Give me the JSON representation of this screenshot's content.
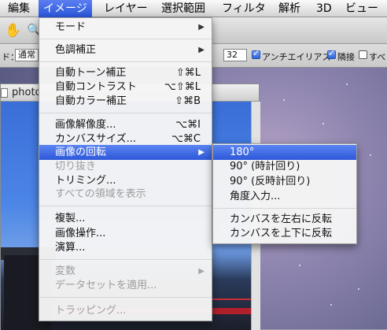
{
  "menubar": {
    "items": [
      "編集",
      "イメージ",
      "レイヤー",
      "選択範囲",
      "フィルタ",
      "解析",
      "3D",
      "ビュー"
    ],
    "active_index": 1
  },
  "toolbar": {
    "mode_label": "ド：",
    "mode_value": "通常",
    "size_value": "32",
    "antialias_label": "アンチエイリアス",
    "contiguous_label": "隣接",
    "all_layers_label": "すべ"
  },
  "document": {
    "title": "photo"
  },
  "image_menu": {
    "items": [
      {
        "label": "モード",
        "shortcut": "",
        "submenu": true,
        "disabled": false
      },
      {
        "label": "色調補正",
        "shortcut": "",
        "submenu": true,
        "disabled": false
      },
      {
        "label": "自動トーン補正",
        "shortcut": "⇧⌘L",
        "submenu": false,
        "disabled": false
      },
      {
        "label": "自動コントラスト",
        "shortcut": "⌥⇧⌘L",
        "submenu": false,
        "disabled": false
      },
      {
        "label": "自動カラー補正",
        "shortcut": "⇧⌘B",
        "submenu": false,
        "disabled": false
      },
      {
        "label": "画像解像度...",
        "shortcut": "⌥⌘I",
        "submenu": false,
        "disabled": false
      },
      {
        "label": "カンバスサイズ...",
        "shortcut": "⌥⌘C",
        "submenu": false,
        "disabled": false
      },
      {
        "label": "画像の回転",
        "shortcut": "",
        "submenu": true,
        "disabled": false,
        "highlighted": true
      },
      {
        "label": "切り抜き",
        "shortcut": "",
        "submenu": false,
        "disabled": true
      },
      {
        "label": "トリミング...",
        "shortcut": "",
        "submenu": false,
        "disabled": false
      },
      {
        "label": "すべての領域を表示",
        "shortcut": "",
        "submenu": false,
        "disabled": true
      },
      {
        "label": "複製...",
        "shortcut": "",
        "submenu": false,
        "disabled": false
      },
      {
        "label": "画像操作...",
        "shortcut": "",
        "submenu": false,
        "disabled": false
      },
      {
        "label": "演算...",
        "shortcut": "",
        "submenu": false,
        "disabled": false
      },
      {
        "label": "変数",
        "shortcut": "",
        "submenu": true,
        "disabled": true
      },
      {
        "label": "データセットを適用...",
        "shortcut": "",
        "submenu": false,
        "disabled": true
      },
      {
        "label": "トラッピング...",
        "shortcut": "",
        "submenu": false,
        "disabled": true
      }
    ]
  },
  "rotate_submenu": {
    "items": [
      {
        "label": "180°",
        "highlighted": true
      },
      {
        "label": "90° (時計回り)"
      },
      {
        "label": "90° (反時計回り)"
      },
      {
        "label": "角度入力..."
      },
      {
        "label": "カンバスを左右に反転"
      },
      {
        "label": "カンバスを上下に反転"
      }
    ]
  },
  "colors": {
    "highlight": "#2d57d8",
    "disabled_text": "#9c9c9c"
  }
}
